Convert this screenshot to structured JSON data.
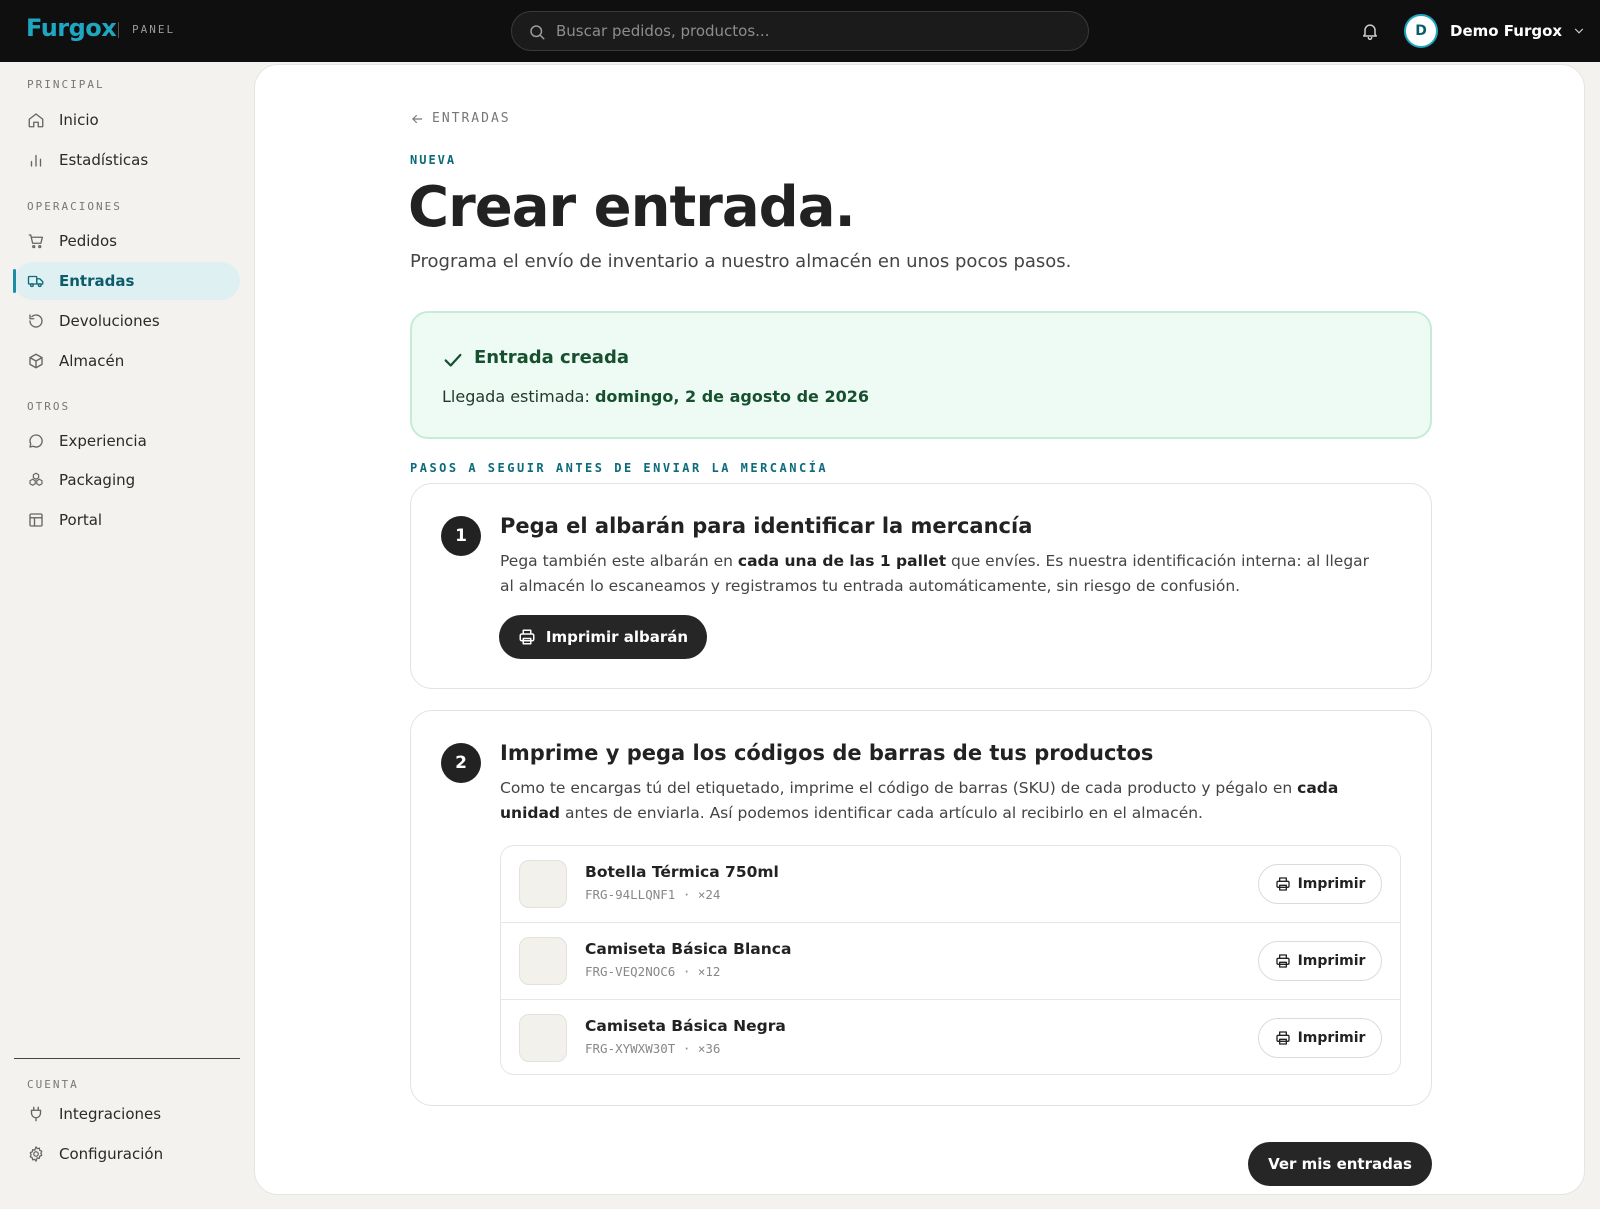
{
  "topbar": {
    "logo": "Furgox",
    "panel_label": "PANEL",
    "search_placeholder": "Buscar pedidos, productos...",
    "user_initial": "D",
    "user_name": "Demo Furgox"
  },
  "sidebar": {
    "sections": [
      {
        "label": "PRINCIPAL",
        "items": [
          {
            "label": "Inicio",
            "icon": "home-icon"
          },
          {
            "label": "Estadísticas",
            "icon": "bar-chart-icon"
          }
        ]
      },
      {
        "label": "OPERACIONES",
        "items": [
          {
            "label": "Pedidos",
            "icon": "cart-icon"
          },
          {
            "label": "Entradas",
            "icon": "truck-icon",
            "active": true
          },
          {
            "label": "Devoluciones",
            "icon": "return-icon"
          },
          {
            "label": "Almacén",
            "icon": "box-icon"
          }
        ]
      },
      {
        "label": "OTROS",
        "items": [
          {
            "label": "Experiencia",
            "icon": "chat-icon"
          },
          {
            "label": "Packaging",
            "icon": "boxes-icon"
          },
          {
            "label": "Portal",
            "icon": "layout-icon"
          }
        ]
      },
      {
        "label": "CUENTA",
        "items": [
          {
            "label": "Integraciones",
            "icon": "plug-icon"
          },
          {
            "label": "Configuración",
            "icon": "gear-icon"
          }
        ]
      }
    ]
  },
  "main": {
    "back_label": "ENTRADAS",
    "eyebrow": "NUEVA",
    "title": "Crear entrada.",
    "subtitle": "Programa el envío de inventario a nuestro almacén en unos pocos pasos.",
    "success": {
      "title": "Entrada creada",
      "arrival_label": "Llegada estimada: ",
      "arrival_date": "domingo, 2 de agosto de 2026"
    },
    "steps_label": "PASOS A SEGUIR ANTES DE ENVIAR LA MERCANCÍA",
    "step1": {
      "number": "1",
      "title": "Pega el albarán para identificar la mercancía",
      "text_a": "Pega también este albarán en ",
      "text_b": "cada una de las 1 pallet",
      "text_c": " que envíes. Es nuestra identificación interna: al llegar al almacén lo escaneamos y registramos tu entrada automáticamente, sin riesgo de confusión.",
      "button": "Imprimir albarán"
    },
    "step2": {
      "number": "2",
      "title": "Imprime y pega los códigos de barras de tus productos",
      "text_a": "Como te encargas tú del etiquetado, imprime el código de barras (SKU) de cada producto y pégalo en ",
      "text_b": "cada unidad",
      "text_c": " antes de enviarla. Así podemos identificar cada artículo al recibirlo en el almacén.",
      "products": [
        {
          "name": "Botella Térmica 750ml",
          "meta": "FRG-94LLQNF1 · ×24",
          "button": "Imprimir"
        },
        {
          "name": "Camiseta Básica Blanca",
          "meta": "FRG-VEQ2NOC6 · ×12",
          "button": "Imprimir"
        },
        {
          "name": "Camiseta Básica Negra",
          "meta": "FRG-XYWXW30T · ×36",
          "button": "Imprimir"
        }
      ]
    },
    "footer_button": "Ver mis entradas"
  },
  "colors": {
    "accent": "#1fa7c2",
    "accent_dark": "#0c5c69",
    "success_bg": "#eefaf4",
    "dark": "#262626"
  }
}
